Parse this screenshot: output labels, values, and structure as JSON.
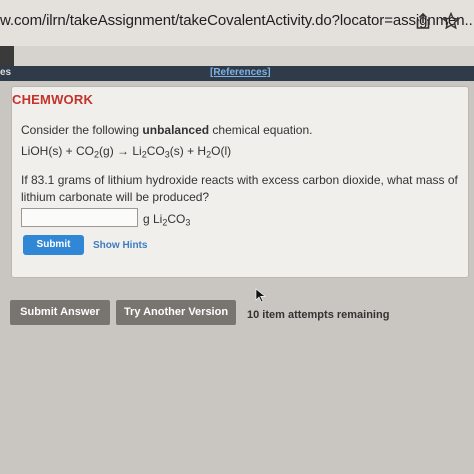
{
  "browser": {
    "url": "w.com/ilrn/takeAssignment/takeCovalentActivity.do?locator=assignmen...",
    "share_icon": "share-icon",
    "bookmark_icon": "star-icon"
  },
  "nav": {
    "tab_partial": "es",
    "references": "[References]"
  },
  "problem": {
    "title": "CHEMWORK",
    "prompt_before": "Consider the following ",
    "prompt_bold": "unbalanced",
    "prompt_after": " chemical equation.",
    "equation": {
      "r1": "LiOH(s) + CO",
      "r1_sub": "2",
      "r1_state": "(g)",
      "arrow": " → ",
      "p1": "Li",
      "p1_sub1": "2",
      "p1_mid": "CO",
      "p1_sub2": "3",
      "p1_state": "(s)",
      "plus": " + H",
      "p2_sub": "2",
      "p2": "O(l)"
    },
    "question": "If 83.1 grams of lithium hydroxide reacts with excess carbon dioxide, what mass of lithium carbonate will be produced?",
    "answer_value": "",
    "unit_prefix": "g Li",
    "unit_sub1": "2",
    "unit_mid": "CO",
    "unit_sub2": "3",
    "submit_label": "Submit",
    "hints_label": "Show Hints"
  },
  "footer": {
    "submit_answer": "Submit Answer",
    "try_another": "Try Another Version",
    "attempts": "10 item attempts remaining"
  },
  "colors": {
    "title_red": "#c3332b",
    "link_blue": "#3c7cc0",
    "submit_blue": "#2f87d6",
    "button_gray": "#78746f"
  }
}
